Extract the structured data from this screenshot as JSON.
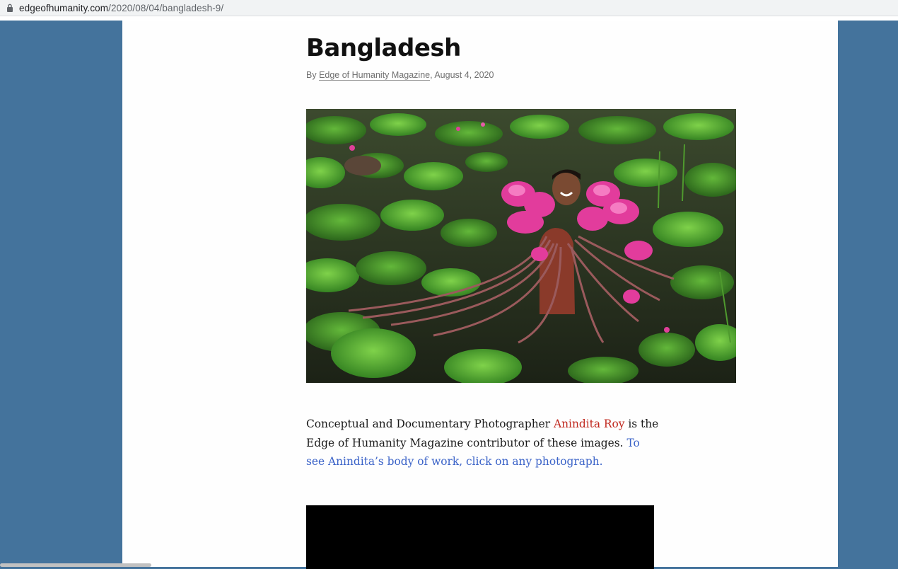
{
  "browser": {
    "url_domain": "edgeofhumanity.com",
    "url_path": "/2020/08/04/bangladesh-9/"
  },
  "article": {
    "title": "Bangladesh",
    "byline_prefix": "By ",
    "author": "Edge of Humanity Magazine",
    "date": ", August 4, 2020",
    "intro_part1": "Conceptual and Documentary Photographer ",
    "photographer": "Anindita Roy",
    "intro_part2": " is the Edge of Humanity Magazine contributor of these images.  ",
    "cta": "To see Anindita’s body of work, click on any photograph."
  },
  "colors": {
    "page_background": "#44739c",
    "content_background": "#fefefe",
    "photographer_link": "#c0281e",
    "cta_link": "#3b63c8"
  },
  "icons": [
    "lock-icon"
  ]
}
